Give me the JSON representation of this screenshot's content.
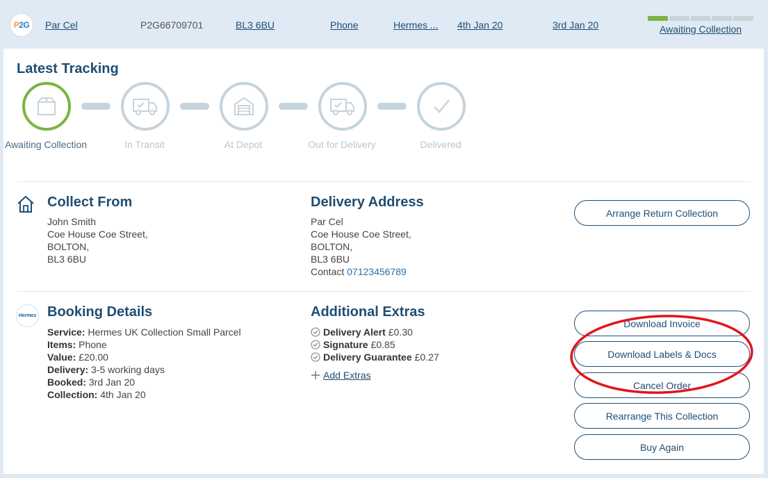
{
  "header": {
    "logo_text": "P2G",
    "recipient": "Par Cel",
    "order_id": "P2G66709701",
    "postcode": "BL3 6BU",
    "item": "Phone",
    "courier": "Hermes ...",
    "collection_date": "4th Jan 20",
    "booked_date": "3rd Jan 20",
    "status": "Awaiting Collection",
    "status_progress": {
      "completed": 1,
      "total": 5
    },
    "accent_color": "#7cb342",
    "link_color": "#1f4d73"
  },
  "tracking": {
    "title": "Latest Tracking",
    "steps": [
      {
        "label": "Awaiting Collection",
        "icon": "box-icon",
        "active": true
      },
      {
        "label": "In Transit",
        "icon": "truck-icon",
        "active": false
      },
      {
        "label": "At Depot",
        "icon": "depot-icon",
        "active": false
      },
      {
        "label": "Out for Delivery",
        "icon": "truck-icon",
        "active": false
      },
      {
        "label": "Delivered",
        "icon": "checkmark-icon",
        "active": false
      }
    ]
  },
  "collect": {
    "title": "Collect From",
    "icon": "house-icon",
    "name": "John Smith",
    "street": "Coe House Coe Street,",
    "city": "BOLTON,",
    "postcode": "BL3 6BU"
  },
  "delivery": {
    "title": "Delivery Address",
    "name": "Par Cel",
    "street": "Coe House Coe Street,",
    "city": "BOLTON,",
    "postcode": "BL3 6BU",
    "contact_label": "Contact",
    "contact_phone": "07123456789"
  },
  "booking": {
    "title": "Booking Details",
    "logo_text": "Hermes",
    "fields": [
      {
        "label": "Service:",
        "value": "Hermes UK Collection Small Parcel"
      },
      {
        "label": "Items:",
        "value": "Phone"
      },
      {
        "label": "Value:",
        "value": "£20.00"
      },
      {
        "label": "Delivery:",
        "value": "3-5 working days"
      },
      {
        "label": "Booked:",
        "value": "3rd Jan 20"
      },
      {
        "label": "Collection:",
        "value": "4th Jan 20"
      }
    ]
  },
  "extras": {
    "title": "Additional Extras",
    "items": [
      {
        "label": "Delivery Alert",
        "price": "£0.30"
      },
      {
        "label": "Signature",
        "price": "£0.85"
      },
      {
        "label": "Delivery Guarantee",
        "price": "£0.27"
      }
    ],
    "add_label": "Add Extras"
  },
  "actions": {
    "arrange_return": "Arrange Return Collection",
    "download_invoice": "Download Invoice",
    "download_labels": "Download Labels & Docs",
    "cancel_order": "Cancel Order",
    "rearrange": "Rearrange This Collection",
    "buy_again": "Buy Again"
  },
  "annotation_color": "#e0141e"
}
